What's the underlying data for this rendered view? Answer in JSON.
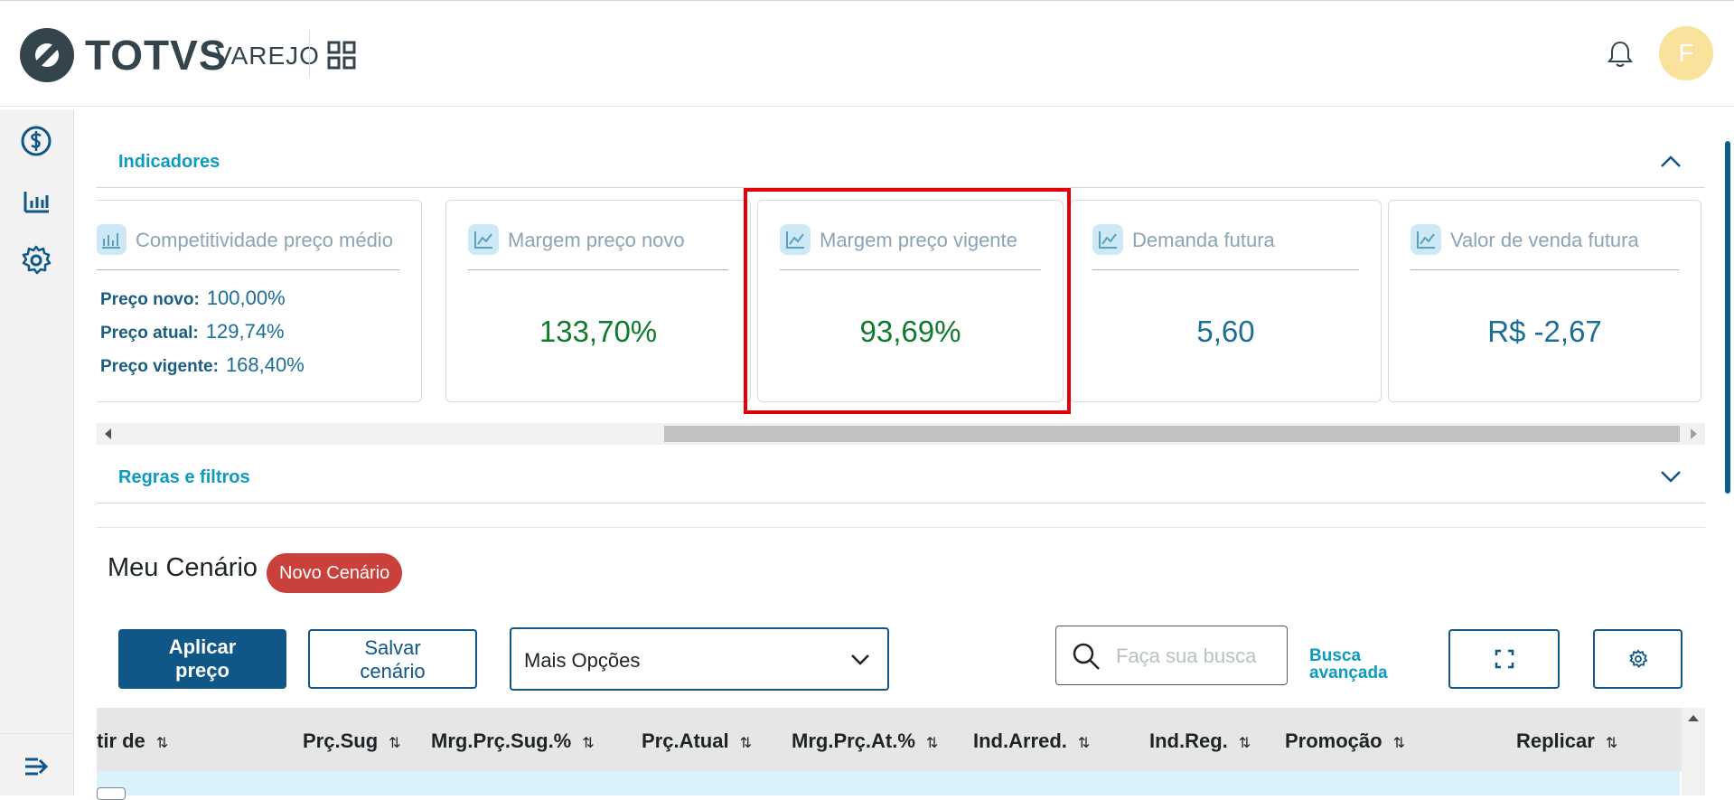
{
  "header": {
    "brand": "TOTVS",
    "product": "VAREJO",
    "avatar_initial": "F"
  },
  "sidebar": {
    "items": [
      {
        "icon": "dollar-circle-icon"
      },
      {
        "icon": "bar-chart-icon"
      },
      {
        "icon": "gear-icon"
      }
    ],
    "bottom_icon": "expand-menu-icon"
  },
  "indicadores": {
    "title": "Indicadores",
    "cards": [
      {
        "title": "Competitividade preço médio",
        "rows": [
          {
            "label": "Preço novo:",
            "value": "100,00%"
          },
          {
            "label": "Preço atual:",
            "value": "129,74%"
          },
          {
            "label": "Preço vigente:",
            "value": "168,40%"
          }
        ]
      },
      {
        "title": "Margem preço novo",
        "value": "133,70%"
      },
      {
        "title": "Margem preço vigente",
        "value": "93,69%"
      },
      {
        "title": "Demanda futura",
        "value": "5,60"
      },
      {
        "title": "Valor de venda futura",
        "value": "R$ -2,67"
      }
    ]
  },
  "regras": {
    "title": "Regras e filtros"
  },
  "scenario": {
    "title": "Meu Cenário",
    "badge": "Novo Cenário"
  },
  "toolbar": {
    "apply_line1": "Aplicar",
    "apply_line2": "preço",
    "save_line1": "Salvar",
    "save_line2": "cenário",
    "select_value": "Mais Opções",
    "search_placeholder": "Faça sua busca",
    "advanced_line1": "Busca",
    "advanced_line2": "avançada"
  },
  "table": {
    "columns": [
      "tir de",
      "Prç.Sug",
      "Mrg.Prç.Sug.%",
      "Prç.Atual",
      "Mrg.Prç.At.%",
      "Ind.Arred.",
      "Ind.Reg.",
      "Promoção",
      "Replicar"
    ],
    "sort_glyph": "⇅"
  },
  "colors": {
    "primary": "#0e5787",
    "accent": "#0c9abe",
    "positive": "#107a2c",
    "badge": "#c9413a",
    "highlight": "#e4000b"
  }
}
